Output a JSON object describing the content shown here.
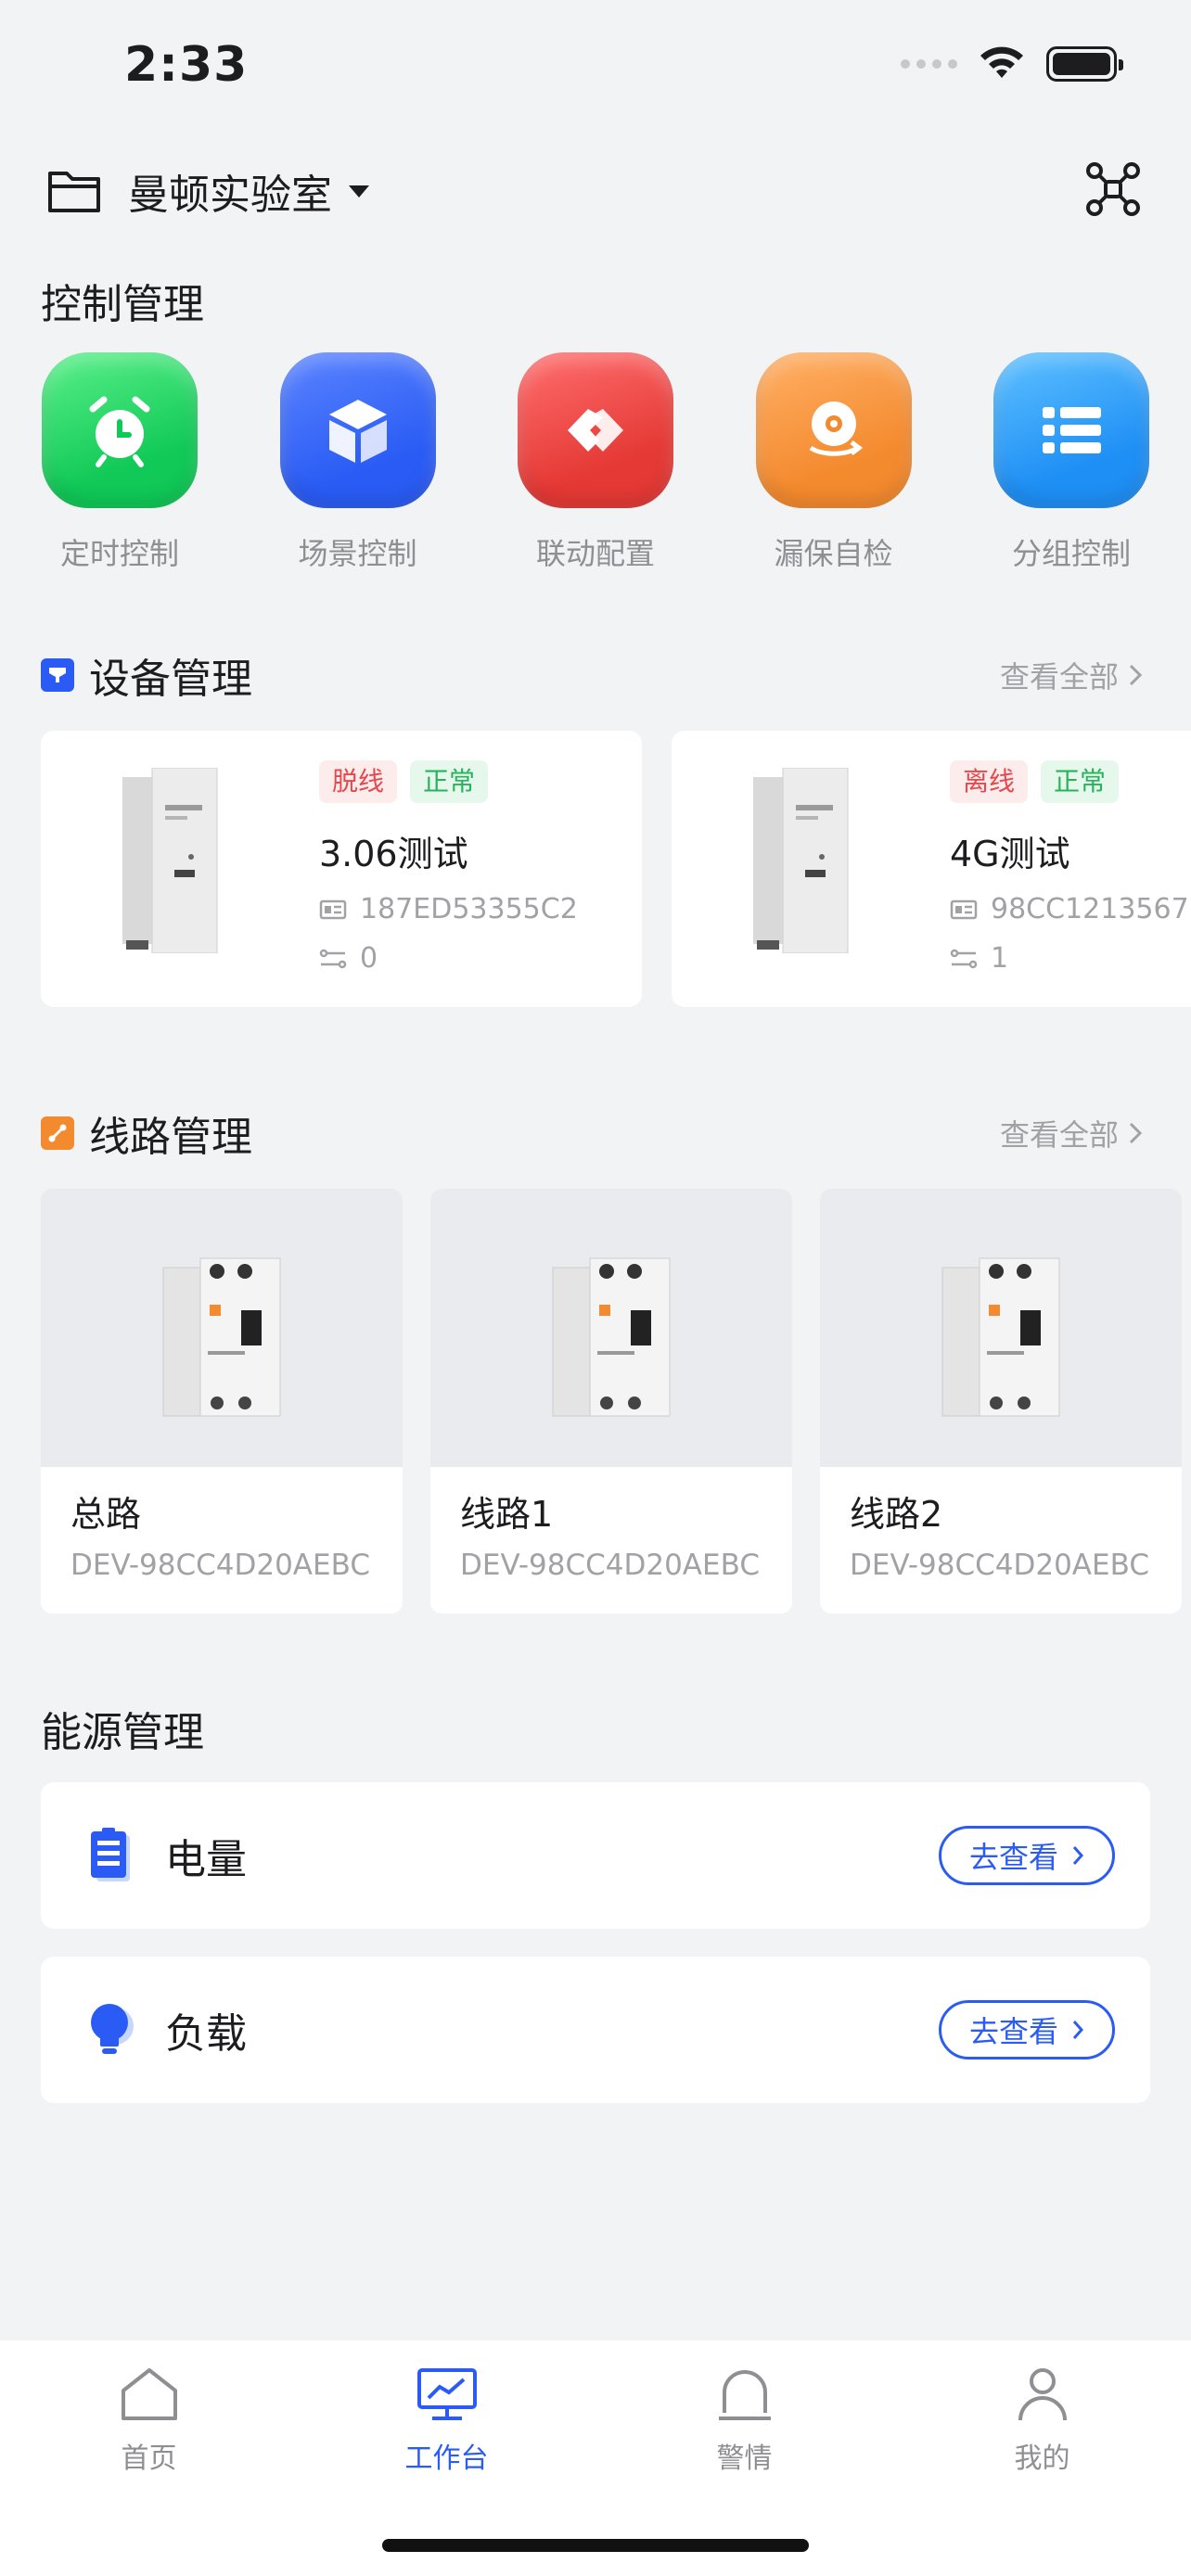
{
  "status_bar": {
    "time": "2:33"
  },
  "header": {
    "location": "曼顿实验室"
  },
  "control": {
    "title": "控制管理",
    "items": [
      {
        "label": "定时控制",
        "icon": "alarm-clock-icon",
        "color": "#10C957"
      },
      {
        "label": "场景控制",
        "icon": "cube-icon",
        "color": "#2A5CF5"
      },
      {
        "label": "联动配置",
        "icon": "link-icon",
        "color": "#E53935"
      },
      {
        "label": "漏保自检",
        "icon": "self-check-icon",
        "color": "#F48A2E"
      },
      {
        "label": "分组控制",
        "icon": "list-icon",
        "color": "#1E8FF5"
      }
    ]
  },
  "devices": {
    "title": "设备管理",
    "see_all": "查看全部",
    "items": [
      {
        "status": "脱线",
        "state": "正常",
        "name": "3.06测试",
        "id": "187ED53355C2",
        "count": "0"
      },
      {
        "status": "离线",
        "state": "正常",
        "name": "4G测试",
        "id": "98CC1213567",
        "count": "1"
      }
    ]
  },
  "lines": {
    "title": "线路管理",
    "see_all": "查看全部",
    "items": [
      {
        "name": "总路",
        "id": "DEV-98CC4D20AEBC"
      },
      {
        "name": "线路1",
        "id": "DEV-98CC4D20AEBC"
      },
      {
        "name": "线路2",
        "id": "DEV-98CC4D20AEBC"
      }
    ]
  },
  "energy": {
    "title": "能源管理",
    "items": [
      {
        "label": "电量",
        "button": "去查看",
        "icon": "battery-icon"
      },
      {
        "label": "负载",
        "button": "去查看",
        "icon": "bulb-icon"
      }
    ]
  },
  "tab_bar": {
    "tabs": [
      {
        "label": "首页",
        "icon": "home-icon",
        "active": false
      },
      {
        "label": "工作台",
        "icon": "workbench-icon",
        "active": true
      },
      {
        "label": "警情",
        "icon": "alarm-bell-icon",
        "active": false
      },
      {
        "label": "我的",
        "icon": "profile-icon",
        "active": false
      }
    ]
  },
  "colors": {
    "accent": "#2A5CF5",
    "background": "#F2F3F5",
    "offline": "#E5484D",
    "normal": "#26B35C"
  }
}
